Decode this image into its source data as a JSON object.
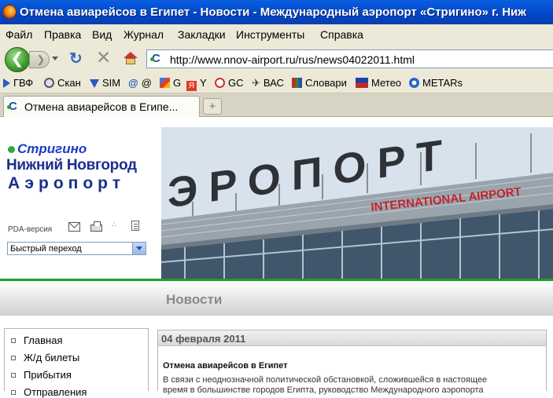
{
  "window": {
    "title": "Отмена авиарейсов в Египет - Новости - Международный аэропорт «Стригино» г. Ниж"
  },
  "menu": [
    "Файл",
    "Правка",
    "Вид",
    "Журнал",
    "Закладки",
    "Инструменты",
    "Справка"
  ],
  "toolbar": {
    "url": "http://www.nnov-airport.ru/rus/news04022011.html"
  },
  "bookmarks": [
    {
      "label": "ГВФ",
      "icon": "arrow-icon"
    },
    {
      "label": "Скан",
      "icon": "radar-icon"
    },
    {
      "label": "SIM",
      "icon": "sim-icon"
    },
    {
      "label": "@",
      "icon": "at-icon"
    },
    {
      "label": "G",
      "icon": "google-icon"
    },
    {
      "label": "Y",
      "icon": "yandex-icon"
    },
    {
      "label": "GC",
      "icon": "gc-icon"
    },
    {
      "label": "ВАС",
      "icon": "plane-icon"
    },
    {
      "label": "Словари",
      "icon": "dictionary-icon"
    },
    {
      "label": "Метео",
      "icon": "weather-icon"
    },
    {
      "label": "METARs",
      "icon": "metar-icon"
    }
  ],
  "tab": {
    "label": "Отмена авиарейсов в Египе..."
  },
  "site": {
    "logo_line1": "Стригино",
    "logo_line2": "Нижний Новгород",
    "logo_line3": "Аэропорт",
    "pda_label": "PDA-версия",
    "quick_jump": "Быстрый переход",
    "banner_text": "ЭРОПОРТ",
    "banner_sign": "INTERNATIONAL AIRPORT",
    "section_title": "Новости",
    "left_menu": [
      "Главная",
      "Ж/д билеты",
      "Прибытия",
      "Отправления"
    ],
    "article": {
      "date": "04 февраля 2011",
      "heading": "Отмена авиарейсов в Египет",
      "body_line1": "В связи с неоднозначной политической обстановкой, сложившейся в настоящее",
      "body_line2": "время в большинстве городов Египта, руководство Международного аэропорта"
    }
  },
  "colors": {
    "titlebar": "#0147c9",
    "chrome": "#ece9d8",
    "brand_blue": "#1a2e8e",
    "brand_green": "#1f9e2a",
    "sign_red": "#c4232b"
  }
}
